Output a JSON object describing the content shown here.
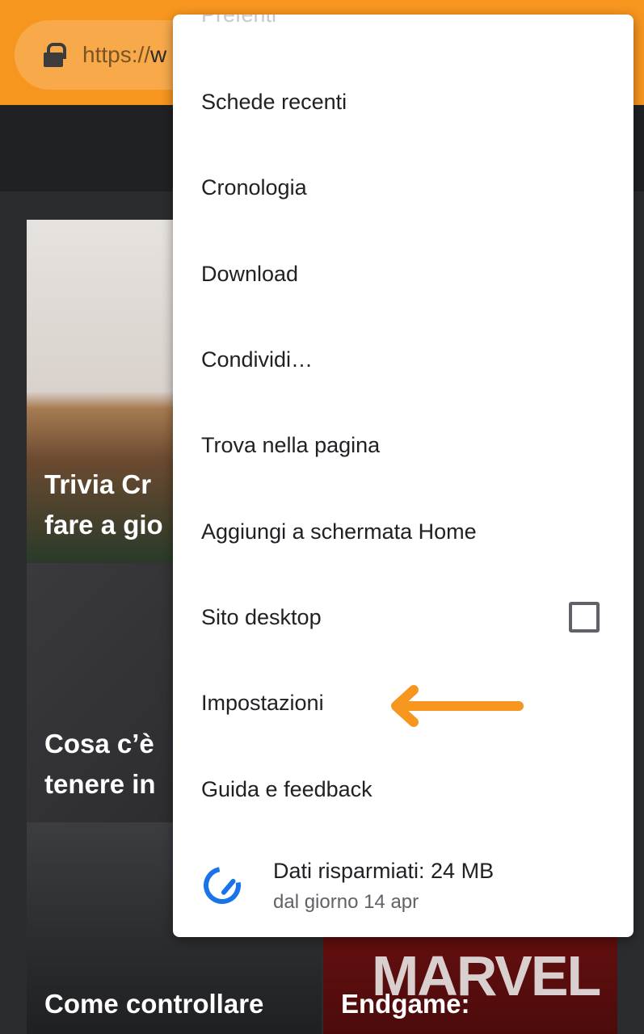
{
  "toolbar": {
    "url_scheme": "https://",
    "url_rest": "w",
    "lock_icon": "lock-icon",
    "color": "#f7961f"
  },
  "cards": [
    {
      "title_line1": "Trivia Cr",
      "title_line2": "fare a gio"
    },
    {
      "title_line1": "Cosa c’è",
      "title_line2": "tenere in"
    },
    {
      "title_line1": "Come controllare"
    },
    {
      "title_line1": "Endgame:",
      "logo": "MARVEL"
    }
  ],
  "menu": {
    "items": [
      {
        "label": "Preferiti"
      },
      {
        "label": "Schede recenti"
      },
      {
        "label": "Cronologia"
      },
      {
        "label": "Download"
      },
      {
        "label": "Condividi…"
      },
      {
        "label": "Trova nella pagina"
      },
      {
        "label": "Aggiungi a schermata Home"
      },
      {
        "label": "Sito desktop",
        "checked": false
      },
      {
        "label": "Impostazioni"
      },
      {
        "label": "Guida e feedback"
      }
    ],
    "data_saver": {
      "title": "Dati risparmiati: 24 MB",
      "subtitle": "dal giorno 14 apr",
      "icon": "speedometer-icon",
      "color": "#1a73e8"
    },
    "annotation_arrow_color": "#f7961f"
  }
}
